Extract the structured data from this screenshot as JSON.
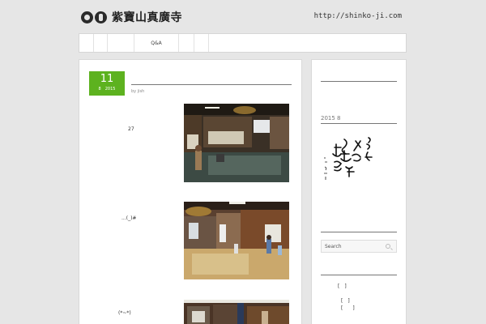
{
  "site": {
    "title": "紫寶山真廣寺",
    "url": "http://shinko-ji.com"
  },
  "nav": {
    "items": [
      "",
      "",
      "",
      "Q&A",
      "",
      ""
    ]
  },
  "post": {
    "day": "11",
    "month_year": "8　2015",
    "byline": "by jish",
    "rows": [
      {
        "text": "27"
      },
      {
        "text": "...(_)#"
      },
      {
        "text": "(*~*)"
      }
    ]
  },
  "sidebar": {
    "archive_label": "2015 8",
    "search_placeholder": "Search",
    "links": [
      "[　]",
      "[　]",
      "[　　]"
    ]
  }
}
